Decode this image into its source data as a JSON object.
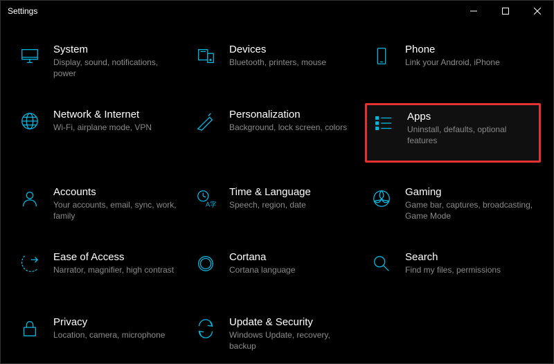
{
  "window": {
    "title": "Settings"
  },
  "tiles": {
    "system": {
      "title": "System",
      "subtitle": "Display, sound, notifications, power"
    },
    "devices": {
      "title": "Devices",
      "subtitle": "Bluetooth, printers, mouse"
    },
    "phone": {
      "title": "Phone",
      "subtitle": "Link your Android, iPhone"
    },
    "network": {
      "title": "Network & Internet",
      "subtitle": "Wi-Fi, airplane mode, VPN"
    },
    "personal": {
      "title": "Personalization",
      "subtitle": "Background, lock screen, colors"
    },
    "apps": {
      "title": "Apps",
      "subtitle": "Uninstall, defaults, optional features"
    },
    "accounts": {
      "title": "Accounts",
      "subtitle": "Your accounts, email, sync, work, family"
    },
    "time": {
      "title": "Time & Language",
      "subtitle": "Speech, region, date"
    },
    "gaming": {
      "title": "Gaming",
      "subtitle": "Game bar, captures, broadcasting, Game Mode"
    },
    "ease": {
      "title": "Ease of Access",
      "subtitle": "Narrator, magnifier, high contrast"
    },
    "cortana": {
      "title": "Cortana",
      "subtitle": "Cortana language"
    },
    "search": {
      "title": "Search",
      "subtitle": "Find my files, permissions"
    },
    "privacy": {
      "title": "Privacy",
      "subtitle": "Location, camera, microphone"
    },
    "update": {
      "title": "Update & Security",
      "subtitle": "Windows Update, recovery, backup"
    }
  },
  "highlighted_tile": "apps",
  "colors": {
    "accent": "#00b7e0",
    "highlight_border": "#e53131"
  }
}
